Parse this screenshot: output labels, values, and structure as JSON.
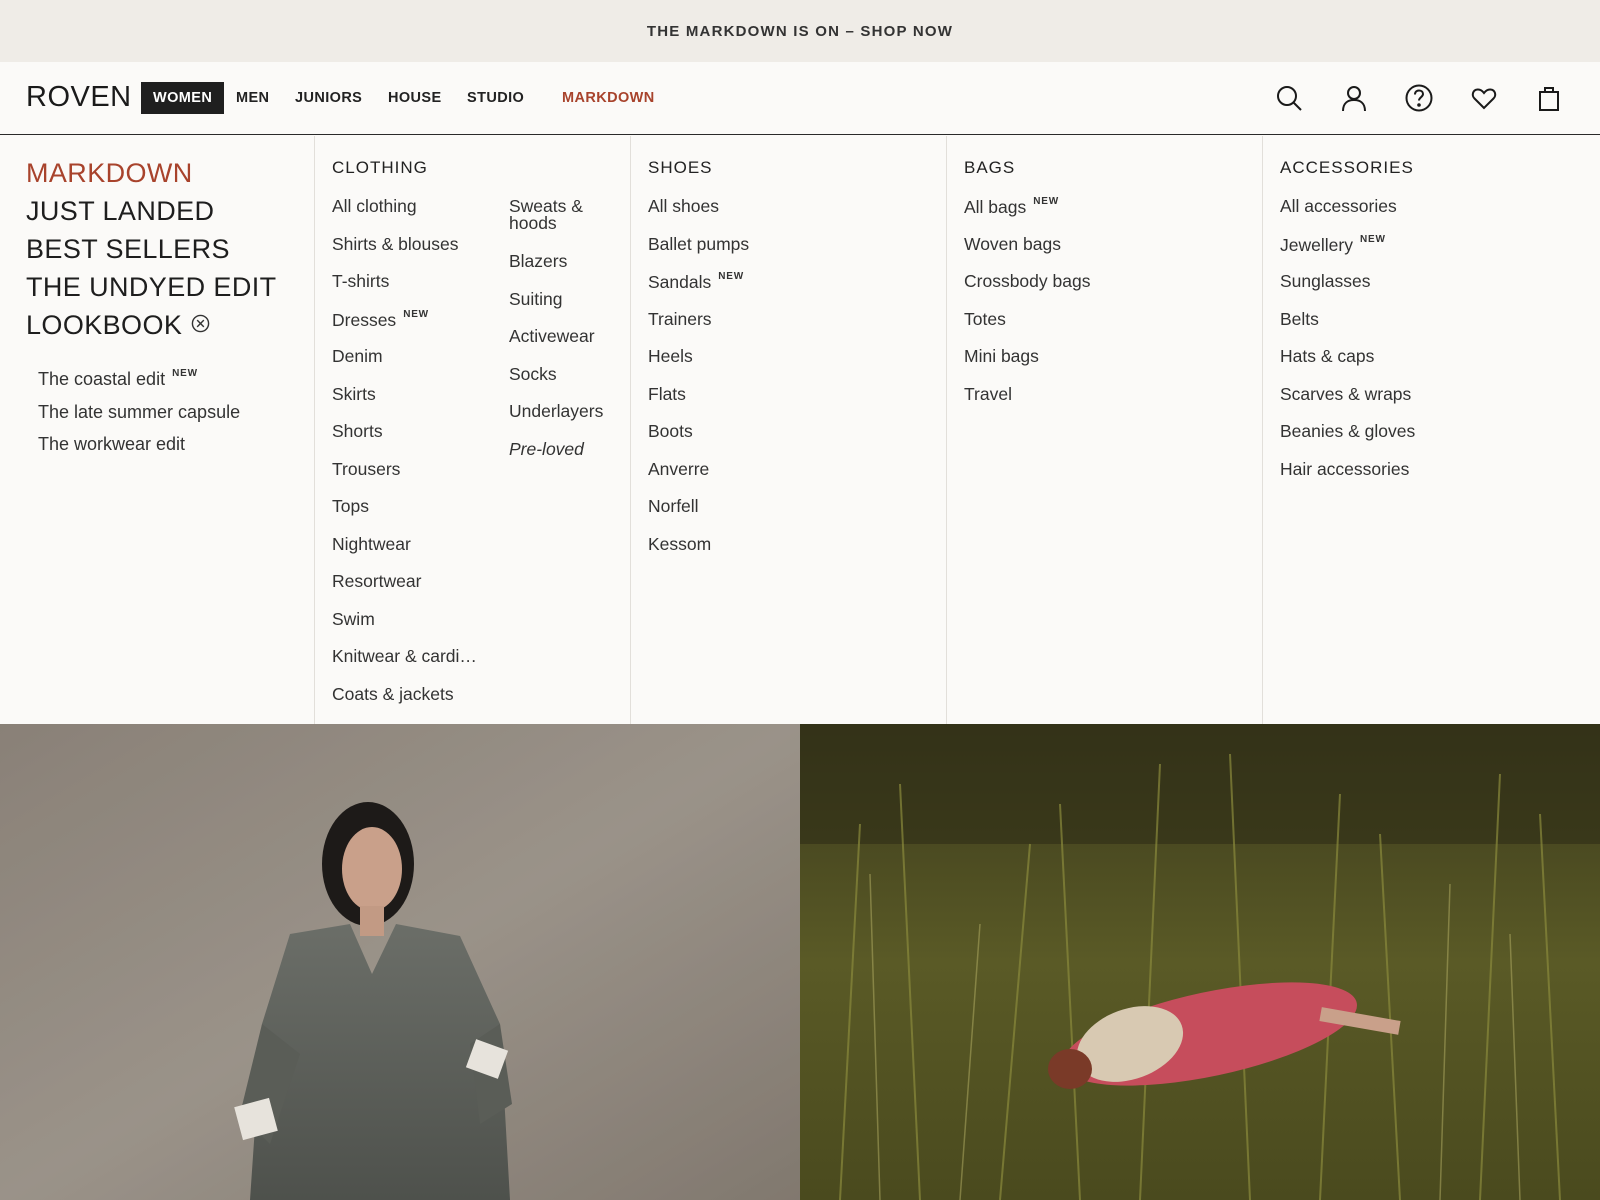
{
  "announcement": "THE MARKDOWN IS ON – SHOP NOW",
  "brand": "ROVEN",
  "nav": {
    "women": "WOMEN",
    "men": "MEN",
    "juniors": "JUNIORS",
    "house": "HOUSE",
    "studio": "STUDIO",
    "markdown": "MARKDOWN"
  },
  "icons": {
    "search": "search-icon",
    "account": "account-icon",
    "help": "help-icon",
    "wishlist": "heart-icon",
    "bag": "shopping-bag-icon"
  },
  "colors": {
    "accent": "#a8432c",
    "active_nav_bg": "#1f1f1f",
    "announcement_bg": "#efece7"
  },
  "featured": {
    "markdown": "MARKDOWN",
    "just_landed": "JUST LANDED",
    "best_sellers": "BEST SELLERS",
    "undyed_edit": "THE UNDYED EDIT",
    "lookbook": "LOOKBOOK",
    "lookbook_links": [
      {
        "label": "The coastal edit",
        "badge": "NEW"
      },
      {
        "label": "The late summer capsule"
      },
      {
        "label": "The workwear edit"
      }
    ]
  },
  "clothing": {
    "heading": "CLOTHING",
    "col1": [
      {
        "label": "All clothing"
      },
      {
        "label": "Shirts & blouses"
      },
      {
        "label": "T-shirts"
      },
      {
        "label": "Dresses",
        "badge": "NEW"
      },
      {
        "label": "Denim"
      },
      {
        "label": "Skirts"
      },
      {
        "label": "Shorts"
      },
      {
        "label": "Trousers"
      },
      {
        "label": "Tops"
      },
      {
        "label": "Nightwear"
      },
      {
        "label": "Resortwear"
      },
      {
        "label": "Swim"
      },
      {
        "label": "Knitwear & cardi…"
      },
      {
        "label": "Coats & jackets"
      }
    ],
    "col2_first_line1": "Sweats &",
    "col2_first_line2": "hoods",
    "col2": [
      {
        "label": "Blazers"
      },
      {
        "label": "Suiting"
      },
      {
        "label": "Activewear"
      },
      {
        "label": "Socks"
      },
      {
        "label": "Underlayers"
      },
      {
        "label": "Pre-loved"
      }
    ]
  },
  "shoes": {
    "heading": "SHOES",
    "items": [
      {
        "label": "All shoes"
      },
      {
        "label": "Ballet pumps"
      },
      {
        "label": "Sandals",
        "badge": "NEW"
      },
      {
        "label": "Trainers"
      },
      {
        "label": "Heels"
      },
      {
        "label": "Flats"
      },
      {
        "label": "Boots"
      },
      {
        "label": "Anverre"
      },
      {
        "label": "Norfell"
      },
      {
        "label": "Kessom"
      }
    ]
  },
  "bags": {
    "heading": "BAGS",
    "items": [
      {
        "label": "All bags",
        "badge": "NEW"
      },
      {
        "label": "Woven bags"
      },
      {
        "label": "Crossbody bags"
      },
      {
        "label": "Totes"
      },
      {
        "label": "Mini bags"
      },
      {
        "label": "Travel"
      }
    ]
  },
  "accessories": {
    "heading": "ACCESSORIES",
    "items": [
      {
        "label": "All accessories"
      },
      {
        "label": "Jewellery",
        "badge": "NEW"
      },
      {
        "label": "Sunglasses"
      },
      {
        "label": "Belts"
      },
      {
        "label": "Hats & caps"
      },
      {
        "label": "Scarves & wraps"
      },
      {
        "label": "Beanies & gloves"
      },
      {
        "label": "Hair accessories"
      }
    ]
  }
}
